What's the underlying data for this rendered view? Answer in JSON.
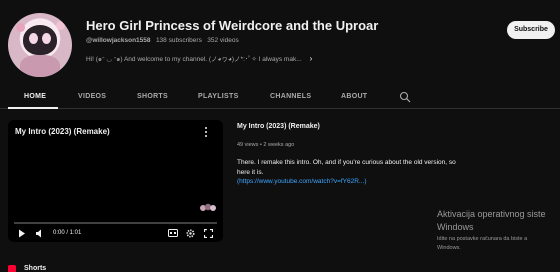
{
  "channel": {
    "title": "Hero Girl Princess of Weirdcore and the Uproar",
    "handle": "@willowjackson1558",
    "subscribers": "138 subscribers",
    "videos": "352 videos",
    "description": "Hi! (๑ᵔ ◡ ᵔ๑) And welcome to my channel. (ノ◕ヮ◕)ノ*:･ﾟ✧ I always mak...",
    "subscribe_label": "Subscribe"
  },
  "tabs": [
    {
      "label": "HOME",
      "active": true
    },
    {
      "label": "VIDEOS"
    },
    {
      "label": "SHORTS"
    },
    {
      "label": "PLAYLISTS"
    },
    {
      "label": "CHANNELS"
    },
    {
      "label": "ABOUT"
    }
  ],
  "player": {
    "title": "My Intro (2023) (Remake)",
    "time": "0:00 / 1:01",
    "progress": 0
  },
  "featured": {
    "title": "My Intro (2023) (Remake)",
    "meta": "49 views • 2 weeks ago",
    "desc_line": "There. I remake this intro. Oh, and if you're curious about the old version, so here it is.",
    "link": "(https://www.youtube.com/watch?v=fY62R...)"
  },
  "watermark": {
    "line1": "Aktivacija operativnog siste",
    "line2": "Windows",
    "line3": "Idite na postavke računara da biste a",
    "line4": "Windows."
  },
  "shorts_section": {
    "label": "Shorts"
  },
  "icons": {
    "search": "search-icon",
    "more": "kebab-menu-icon",
    "play": "play-icon",
    "volume": "volume-icon",
    "captions": "captions-icon",
    "settings": "gear-icon",
    "fullscreen": "fullscreen-icon",
    "shorts": "shorts-icon"
  },
  "colors": {
    "background": "#0f0f0f",
    "text": "#f1f1f1",
    "secondary": "#aaaaaa",
    "link": "#3ea6ff",
    "subscribe_bg": "#f1f1f1"
  }
}
